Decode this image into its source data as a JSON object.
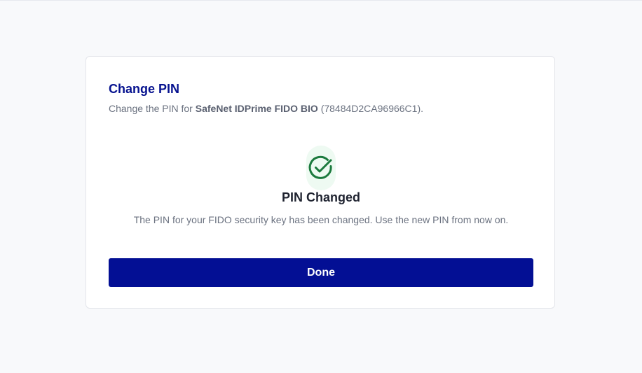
{
  "dialog": {
    "title": "Change PIN",
    "subtitle_prefix": "Change the PIN for ",
    "device_name": "SafeNet IDPrime FIDO BIO",
    "device_serial": "(78484D2CA96966C1).",
    "status": {
      "icon": "check-circle-icon",
      "title": "PIN Changed",
      "message": "The PIN for your FIDO security key has been changed. Use the new PIN from now on."
    },
    "done_label": "Done"
  },
  "colors": {
    "accent": "#030f94",
    "title": "#06128f",
    "success": "#1c7a3e",
    "success_bg": "#eefaf2",
    "background": "#f8f9fb"
  }
}
